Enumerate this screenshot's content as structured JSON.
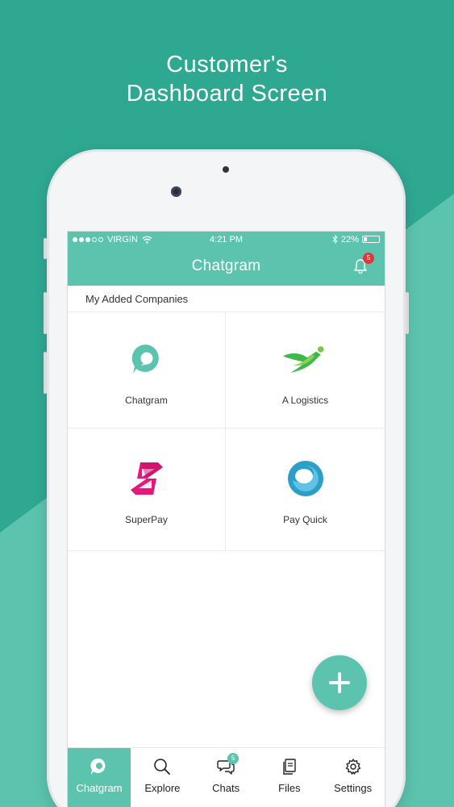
{
  "promo": {
    "title_line1": "Customer's",
    "title_line2": "Dashboard Screen"
  },
  "status_bar": {
    "carrier": "VIRGIN",
    "time": "4:21 PM",
    "battery": "22%",
    "battery_level": 0.22,
    "signal_bars_filled": 3,
    "signal_bars_total": 5
  },
  "app_bar": {
    "title": "Chatgram",
    "notification_count": "5"
  },
  "section": {
    "title": "My Added Companies"
  },
  "companies": [
    {
      "name": "Chatgram",
      "icon": "chatgram-logo-icon"
    },
    {
      "name": "A Logistics",
      "icon": "a-logistics-logo-icon"
    },
    {
      "name": "SuperPay",
      "icon": "superpay-logo-icon"
    },
    {
      "name": "Pay Quick",
      "icon": "pay-quick-logo-icon"
    }
  ],
  "fab": {
    "icon": "plus-icon"
  },
  "tabs": [
    {
      "label": "Chatgram",
      "icon": "chatgram-icon",
      "active": true
    },
    {
      "label": "Explore",
      "icon": "search-icon",
      "active": false
    },
    {
      "label": "Chats",
      "icon": "chat-bubbles-icon",
      "active": false,
      "badge": "5"
    },
    {
      "label": "Files",
      "icon": "files-icon",
      "active": false
    },
    {
      "label": "Settings",
      "icon": "gear-icon",
      "active": false
    }
  ],
  "colors": {
    "background_dark": "#2fa892",
    "background_light": "#5cc4ae",
    "accent": "#5cc4ae",
    "notification_badge": "#e0363c",
    "superpay_pink": "#e5177b",
    "logistics_green": "#3cb94a"
  }
}
